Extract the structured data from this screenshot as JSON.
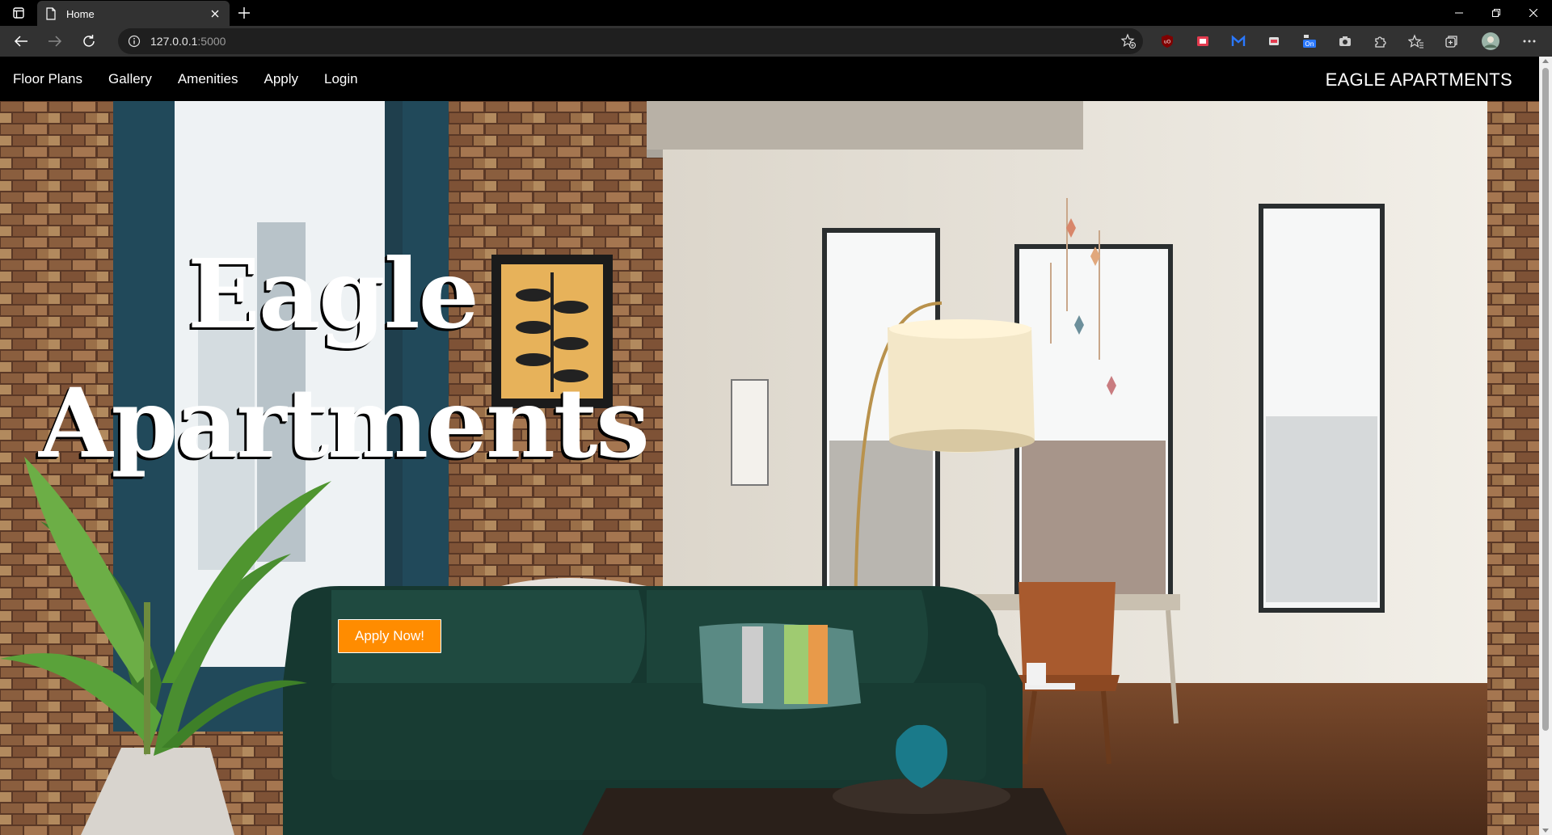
{
  "browser": {
    "tab_title": "Home",
    "url_host": "127.0.0.1",
    "url_port": ":5000"
  },
  "site": {
    "nav": [
      "Floor Plans",
      "Gallery",
      "Amenities",
      "Apply",
      "Login"
    ],
    "brand": "EAGLE APARTMENTS"
  },
  "hero": {
    "title_line1": "Eagle",
    "title_line2": "Apartments",
    "cta": "Apply Now!",
    "cta_color": "#ff8c00"
  },
  "icons": {
    "extensions": [
      "ublock-icon",
      "pdf-icon",
      "mail-icon",
      "print-icon",
      "on-badge-icon",
      "camera-icon",
      "puzzle-icon",
      "favorites-icon",
      "collections-icon",
      "profile-avatar",
      "more-icon"
    ]
  }
}
